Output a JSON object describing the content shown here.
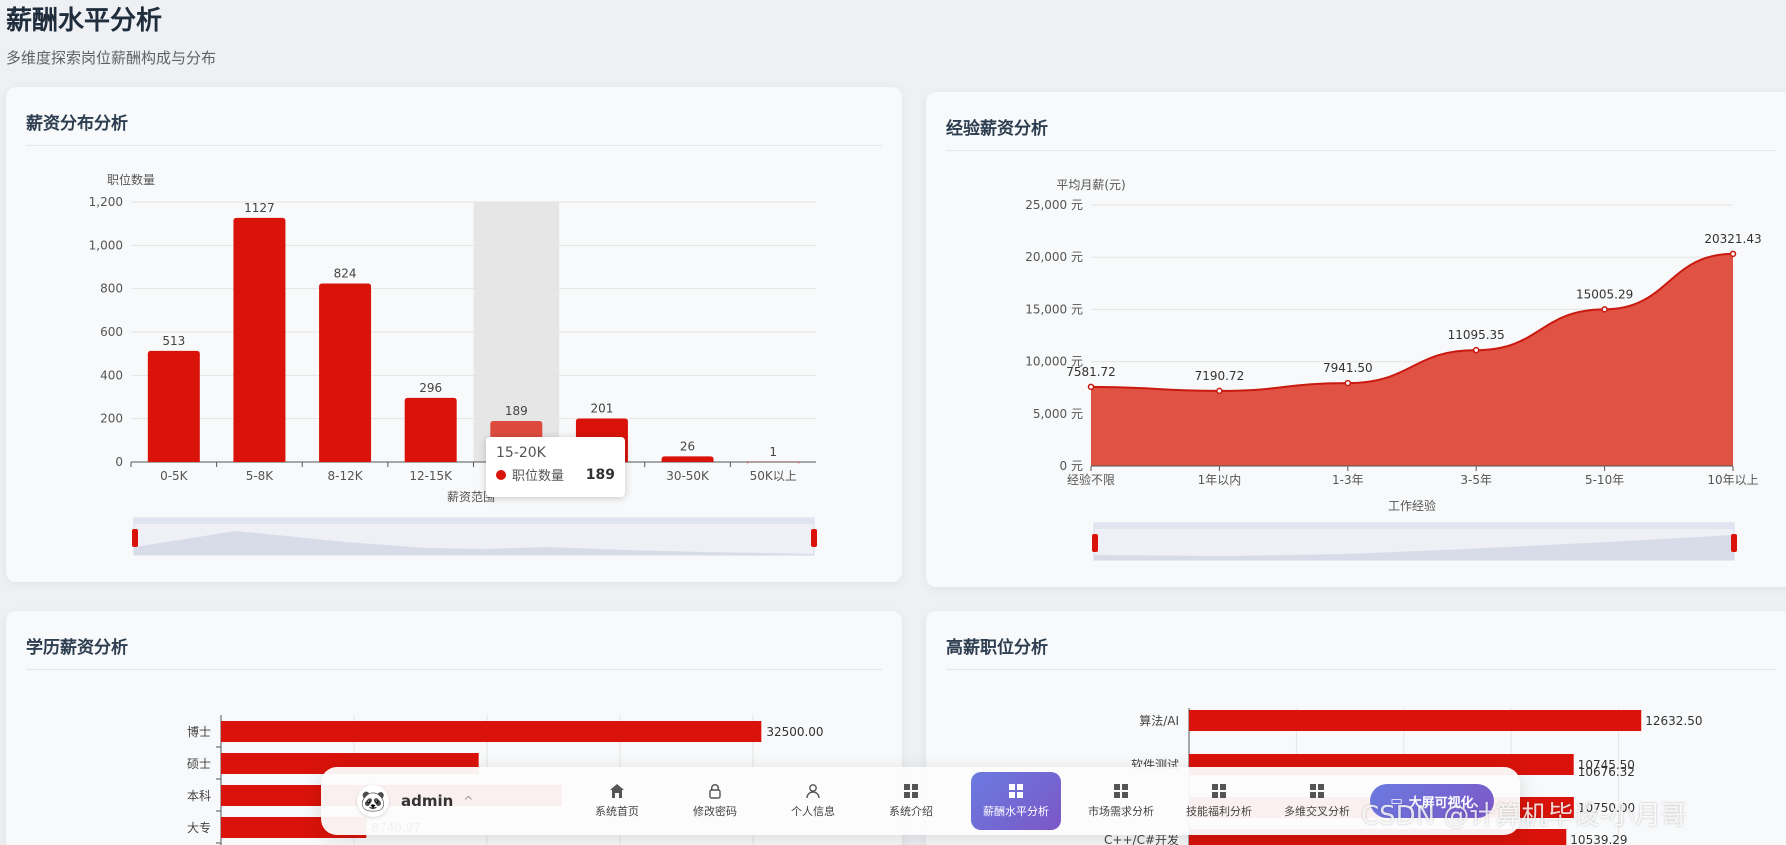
{
  "page": {
    "title": "薪酬水平分析",
    "subtitle": "多维度探索岗位薪酬构成与分布"
  },
  "cards": {
    "salary_distribution": {
      "title": "薪资分布分析"
    },
    "experience_salary": {
      "title": "经验薪资分析"
    },
    "education_salary": {
      "title": "学历薪资分析"
    },
    "high_salary": {
      "title": "高薪职位分析"
    }
  },
  "tooltip": {
    "title": "15-20K",
    "series": "职位数量",
    "value": "189"
  },
  "navbar": {
    "user": "admin",
    "items": [
      {
        "label": "系统首页",
        "icon": "home-icon"
      },
      {
        "label": "修改密码",
        "icon": "lock-icon"
      },
      {
        "label": "个人信息",
        "icon": "user-icon"
      },
      {
        "label": "系统介绍",
        "icon": "grid-icon"
      },
      {
        "label": "薪酬水平分析",
        "icon": "grid-icon"
      },
      {
        "label": "市场需求分析",
        "icon": "grid-icon"
      },
      {
        "label": "技能福利分析",
        "icon": "grid-icon"
      },
      {
        "label": "多维交叉分析",
        "icon": "grid-icon"
      }
    ],
    "bigscreen_label": "大屏可视化"
  },
  "watermark": "CSDN @计算机毕设-小月哥",
  "colors": {
    "bar": "#d9130a",
    "area": "#e05243",
    "active": "#6a7be0"
  },
  "chart_data": [
    {
      "type": "bar",
      "categories": [
        "0-5K",
        "5-8K",
        "8-12K",
        "12-15K",
        "15-20K",
        "20-30K",
        "30-50K",
        "50K以上"
      ],
      "series": [
        {
          "name": "职位数量",
          "values": [
            513,
            1127,
            824,
            296,
            189,
            201,
            26,
            1
          ]
        }
      ],
      "ylabel": "职位数量",
      "xlabel": "薪资范围",
      "ylim": [
        0,
        1200
      ],
      "yticks": [
        "0",
        "200",
        "400",
        "600",
        "800",
        "1,000",
        "1,200"
      ],
      "highlight_category": "15-20K"
    },
    {
      "type": "area",
      "categories": [
        "经验不限",
        "1年以内",
        "1-3年",
        "3-5年",
        "5-10年",
        "10年以上"
      ],
      "values": [
        7581.72,
        7190.72,
        7941.5,
        11095.35,
        15005.29,
        20321.43
      ],
      "value_labels": [
        "7581.72",
        "7190.72",
        "7941.50",
        "11095.35",
        "15005.29",
        "20321.43"
      ],
      "ylabel": "平均月薪(元)",
      "xlabel": "工作经验",
      "ylim": [
        0,
        25000
      ],
      "yticks": [
        "0 元",
        "5,000 元",
        "10,000 元",
        "15,000 元",
        "20,000 元",
        "25,000 元"
      ]
    },
    {
      "type": "bar",
      "orientation": "horizontal",
      "categories": [
        "博士",
        "硕士",
        "本科",
        "大专"
      ],
      "values": [
        32500.0,
        null,
        null,
        8740.97
      ],
      "value_labels": [
        "32500.00",
        "",
        "",
        "8740.97"
      ]
    },
    {
      "type": "bar",
      "orientation": "horizontal",
      "categories": [
        "算法/AI",
        "软件测试",
        "",
        "C++/C#开发"
      ],
      "values": [
        12632.5,
        10745.5,
        10750.0,
        10539.29
      ],
      "value_labels": [
        "12632.50",
        "10745.50",
        "10750.00",
        "10539.29"
      ],
      "extra_labels": [
        "10676.32"
      ]
    }
  ]
}
